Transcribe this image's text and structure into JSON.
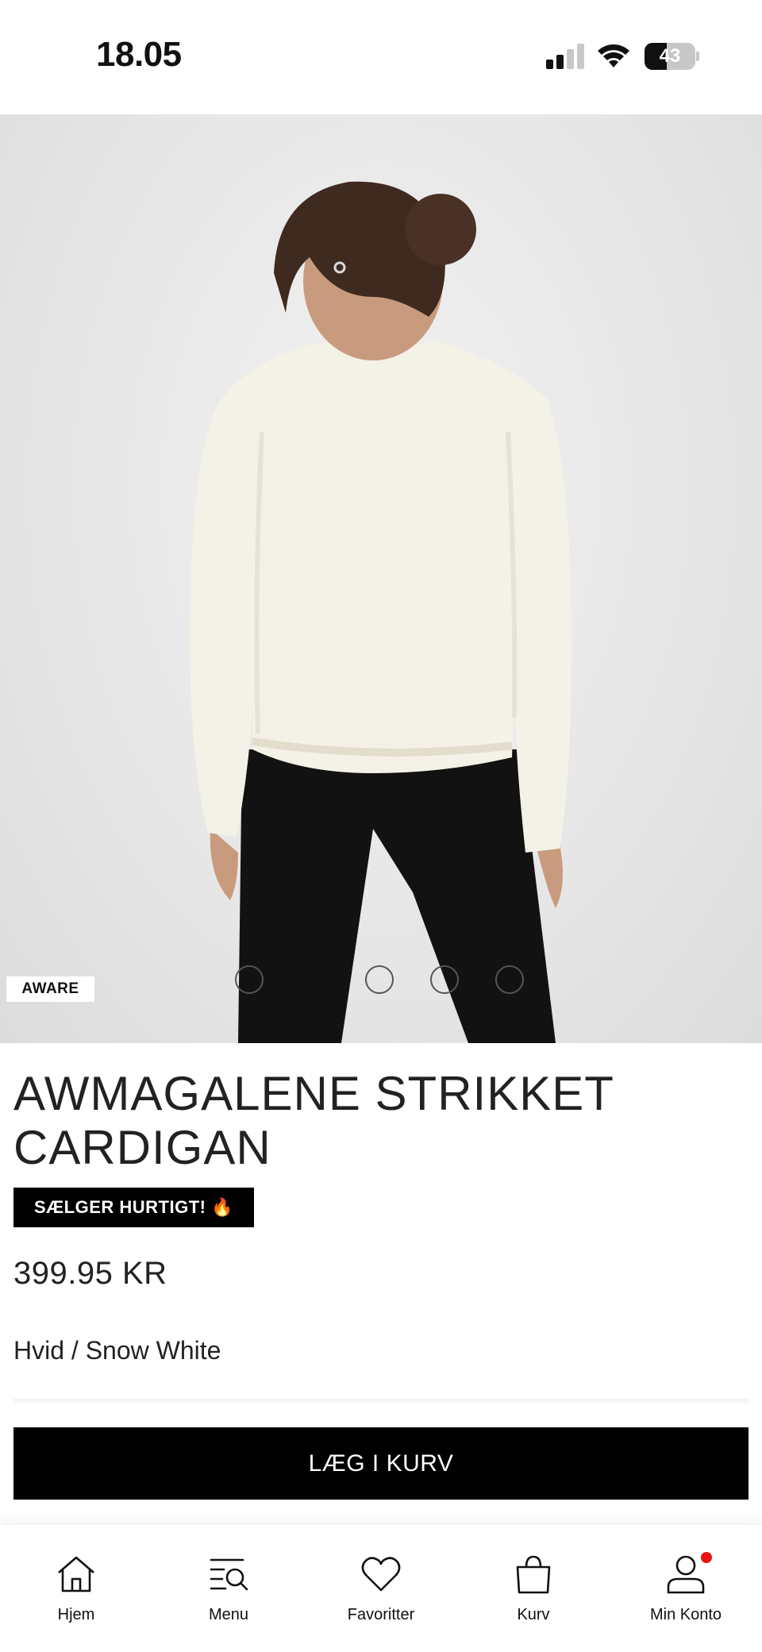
{
  "status_bar": {
    "time": "18.05",
    "battery": "43",
    "battery_level": 0.43,
    "signal_bars_filled": 2,
    "signal_bars_total": 4
  },
  "product": {
    "brand_tag": "AWARE",
    "image_count": 5,
    "active_image_index": 1,
    "title": "AWMAGALENE STRIKKET CARDIGAN",
    "badge": "SÆLGER HURTIGT! 🔥",
    "price": "399.95 KR",
    "color": "Hvid / Snow White",
    "add_to_cart_label": "LÆG I KURV"
  },
  "bottom_nav": {
    "items": [
      {
        "label": "Hjem",
        "icon": "home-icon"
      },
      {
        "label": "Menu",
        "icon": "menu-search-icon"
      },
      {
        "label": "Favoritter",
        "icon": "heart-icon"
      },
      {
        "label": "Kurv",
        "icon": "bag-icon"
      },
      {
        "label": "Min Konto",
        "icon": "user-icon",
        "has_notification": true
      }
    ]
  },
  "colors": {
    "accent": "#000000",
    "notification": "#e11111",
    "sweater": "#f4f1e6",
    "pants": "#111111"
  }
}
